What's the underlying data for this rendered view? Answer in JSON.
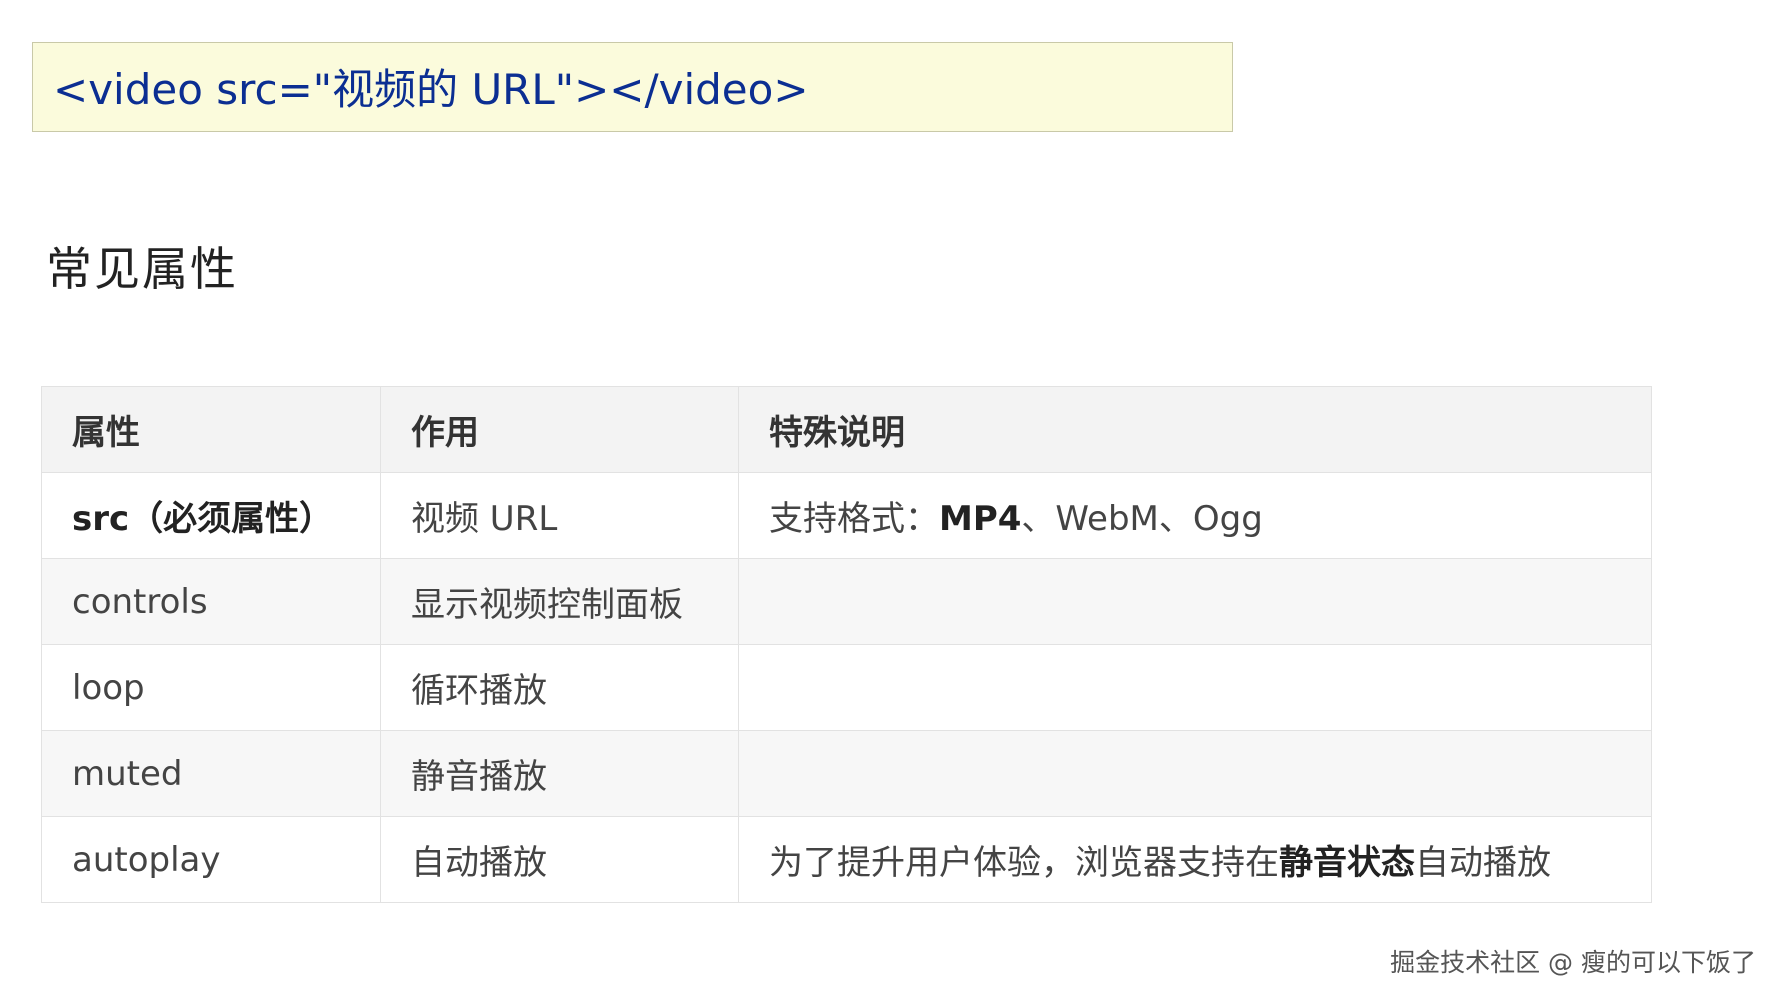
{
  "code_box": {
    "text": "<video src=\"视频的 URL\"></video>"
  },
  "section_title": "常见属性",
  "table": {
    "headers": [
      "属性",
      "作用",
      "特殊说明"
    ],
    "rows": [
      {
        "attr": "src（必须属性）",
        "effect": "视频 URL",
        "note_prefix": "支持格式：",
        "note_bold": "MP4",
        "note_suffix": "、WebM、Ogg"
      },
      {
        "attr": "controls",
        "effect": "显示视频控制面板",
        "note": ""
      },
      {
        "attr": "loop",
        "effect": "循环播放",
        "note": ""
      },
      {
        "attr": "muted",
        "effect": "静音播放",
        "note": ""
      },
      {
        "attr": "autoplay",
        "effect": "自动播放",
        "note_prefix": "为了提升用户体验，浏览器支持在",
        "note_bold": "静音状态",
        "note_suffix": "自动播放"
      }
    ]
  },
  "watermark": "掘金技术社区 @ 瘦的可以下饭了"
}
